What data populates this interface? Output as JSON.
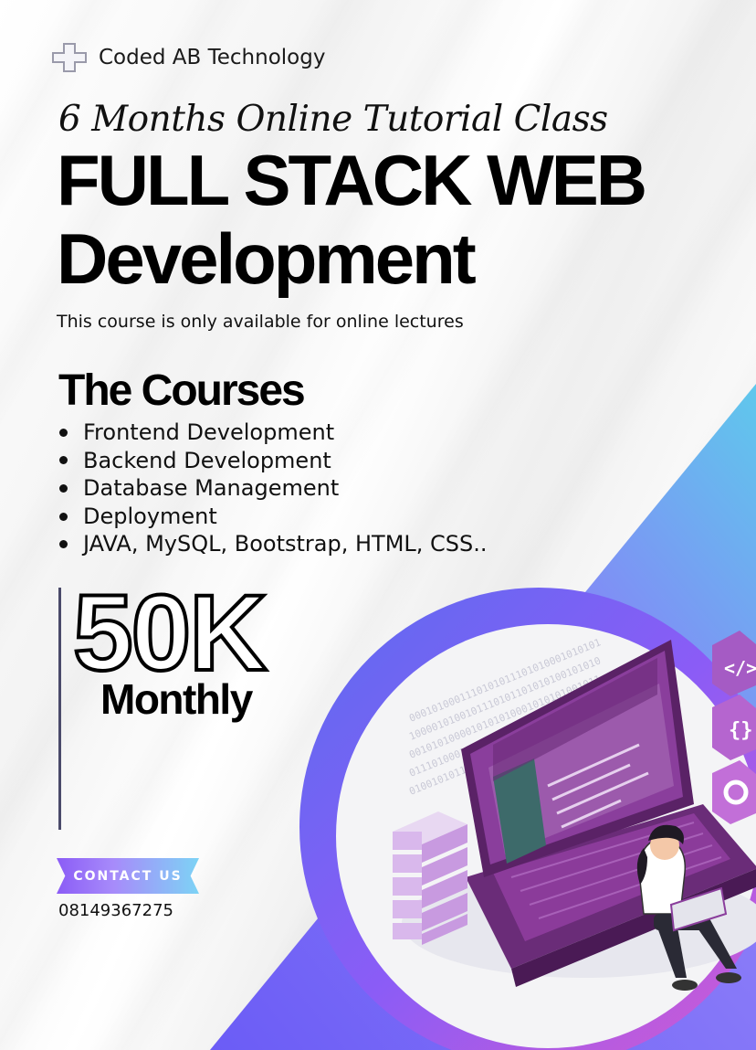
{
  "brand": {
    "name": "Coded AB Technology",
    "icon": "plus-logo-icon"
  },
  "tagline": "6 Months Online Tutorial Class",
  "title": {
    "line1": "FULL STACK WEB",
    "line2": "Development"
  },
  "subtitle": "This course is only available for online lectures",
  "courses": {
    "heading": "The Courses",
    "items": [
      "Frontend Development",
      "Backend Development",
      "Database Management",
      "Deployment",
      "JAVA, MySQL, Bootstrap, HTML, CSS.."
    ]
  },
  "price": {
    "amount": "50K",
    "period": "Monthly"
  },
  "contact": {
    "button_label": "CONTACT US",
    "phone": "08149367275"
  },
  "colors": {
    "purple": "#7c3aed",
    "blue": "#5b6cf0",
    "cyan": "#5fc8ec",
    "magenta": "#c45ad8"
  }
}
